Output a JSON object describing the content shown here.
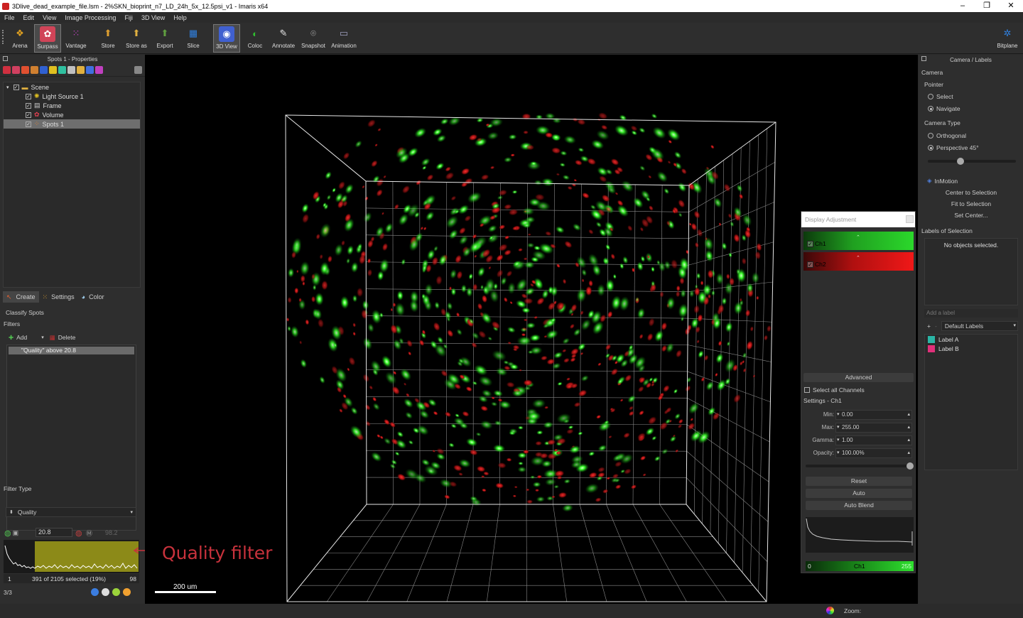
{
  "window": {
    "title": "3Dlive_dead_example_file.lsm - 2%SKN_bioprint_n7_LD_24h_5x_12.5psi_v1 - Imaris x64"
  },
  "menu": [
    "File",
    "Edit",
    "View",
    "Image Processing",
    "Fiji",
    "3D View",
    "Help"
  ],
  "toolbar": {
    "tools": [
      {
        "label": "Arena",
        "icon": "arena-icon",
        "color": "#e0a020"
      },
      {
        "label": "Surpass",
        "icon": "surpass-icon",
        "color": "#e04050"
      },
      {
        "label": "Vantage",
        "icon": "vantage-icon",
        "color": "#c040c0"
      },
      {
        "label": "Store",
        "icon": "store-icon",
        "color": "#e0a030"
      },
      {
        "label": "Store as",
        "icon": "store-as-icon",
        "color": "#e0b040"
      },
      {
        "label": "Export",
        "icon": "export-icon",
        "color": "#60a040"
      },
      {
        "label": "Slice",
        "icon": "slice-icon",
        "color": "#3060c0"
      },
      {
        "label": "3D View",
        "icon": "3d-view-icon",
        "color": "#4060d0"
      },
      {
        "label": "Coloc",
        "icon": "coloc-icon",
        "color": "#30a030"
      },
      {
        "label": "Annotate",
        "icon": "annotate-icon",
        "color": "#d04040"
      },
      {
        "label": "Snapshot",
        "icon": "snapshot-icon",
        "color": "#909090"
      },
      {
        "label": "Animation",
        "icon": "animation-icon",
        "color": "#8080a0"
      }
    ],
    "right_tool": {
      "label": "Bitplane",
      "icon": "bitplane-icon"
    }
  },
  "left": {
    "panel_title": "Spots 1 - Properties",
    "tree": [
      {
        "label": "Scene",
        "icon": "folder-icon"
      },
      {
        "label": "Light Source 1",
        "icon": "light-icon"
      },
      {
        "label": "Frame",
        "icon": "frame-icon"
      },
      {
        "label": "Volume",
        "icon": "volume-icon"
      },
      {
        "label": "Spots 1",
        "icon": "spots-icon"
      }
    ],
    "tabs": [
      "Create",
      "Settings",
      "Color"
    ],
    "classify": "Classify Spots",
    "filters_heading": "Filters",
    "add_label": "Add",
    "delete_label": "Delete",
    "filter_item": "\"Quality\" above 20.8",
    "filter_type_label": "Filter Type",
    "filter_type_value": "Quality",
    "threshold_low": "20.8",
    "threshold_high": "98.2",
    "histogram_annotation": "Quality filter",
    "status_min": "1",
    "status_text": "391 of 2105 selected (19%)",
    "status_max": "98",
    "page": "3/3"
  },
  "viewport": {
    "scale_bar": "200 um"
  },
  "right": {
    "title": "Camera / Labels",
    "camera": "Camera",
    "pointer": "Pointer",
    "select": "Select",
    "navigate": "Navigate",
    "camera_type": "Camera Type",
    "orthogonal": "Orthogonal",
    "perspective": "Perspective 45°",
    "inmotion": "InMotion",
    "center_selection": "Center to Selection",
    "fit_selection": "Fit to Selection",
    "set_center": "Set Center...",
    "labels_of_selection": "Labels of Selection",
    "no_objects": "No objects selected.",
    "add_label_placeholder": "Add a label",
    "default_labels": "Default Labels",
    "label_a": "Label A",
    "label_b": "Label B",
    "label_a_color": "#2ab5a5",
    "label_b_color": "#e0307a"
  },
  "display": {
    "title": "Display Adjustment",
    "ch1": "Ch1",
    "ch2": "Ch2",
    "advanced": "Advanced",
    "select_all": "Select all Channels",
    "settings": "Settings - Ch1",
    "min_label": "Min:",
    "min_value": "0.00",
    "max_label": "Max:",
    "max_value": "255.00",
    "gamma_label": "Gamma:",
    "gamma_value": "1.00",
    "opacity_label": "Opacity:",
    "opacity_value": "100.00%",
    "reset": "Reset",
    "auto": "Auto",
    "auto_blend": "Auto Blend",
    "range_min": "0",
    "range_channel": "Ch1",
    "range_max": "255"
  },
  "bottom": {
    "zoom_label": "Zoom:"
  }
}
